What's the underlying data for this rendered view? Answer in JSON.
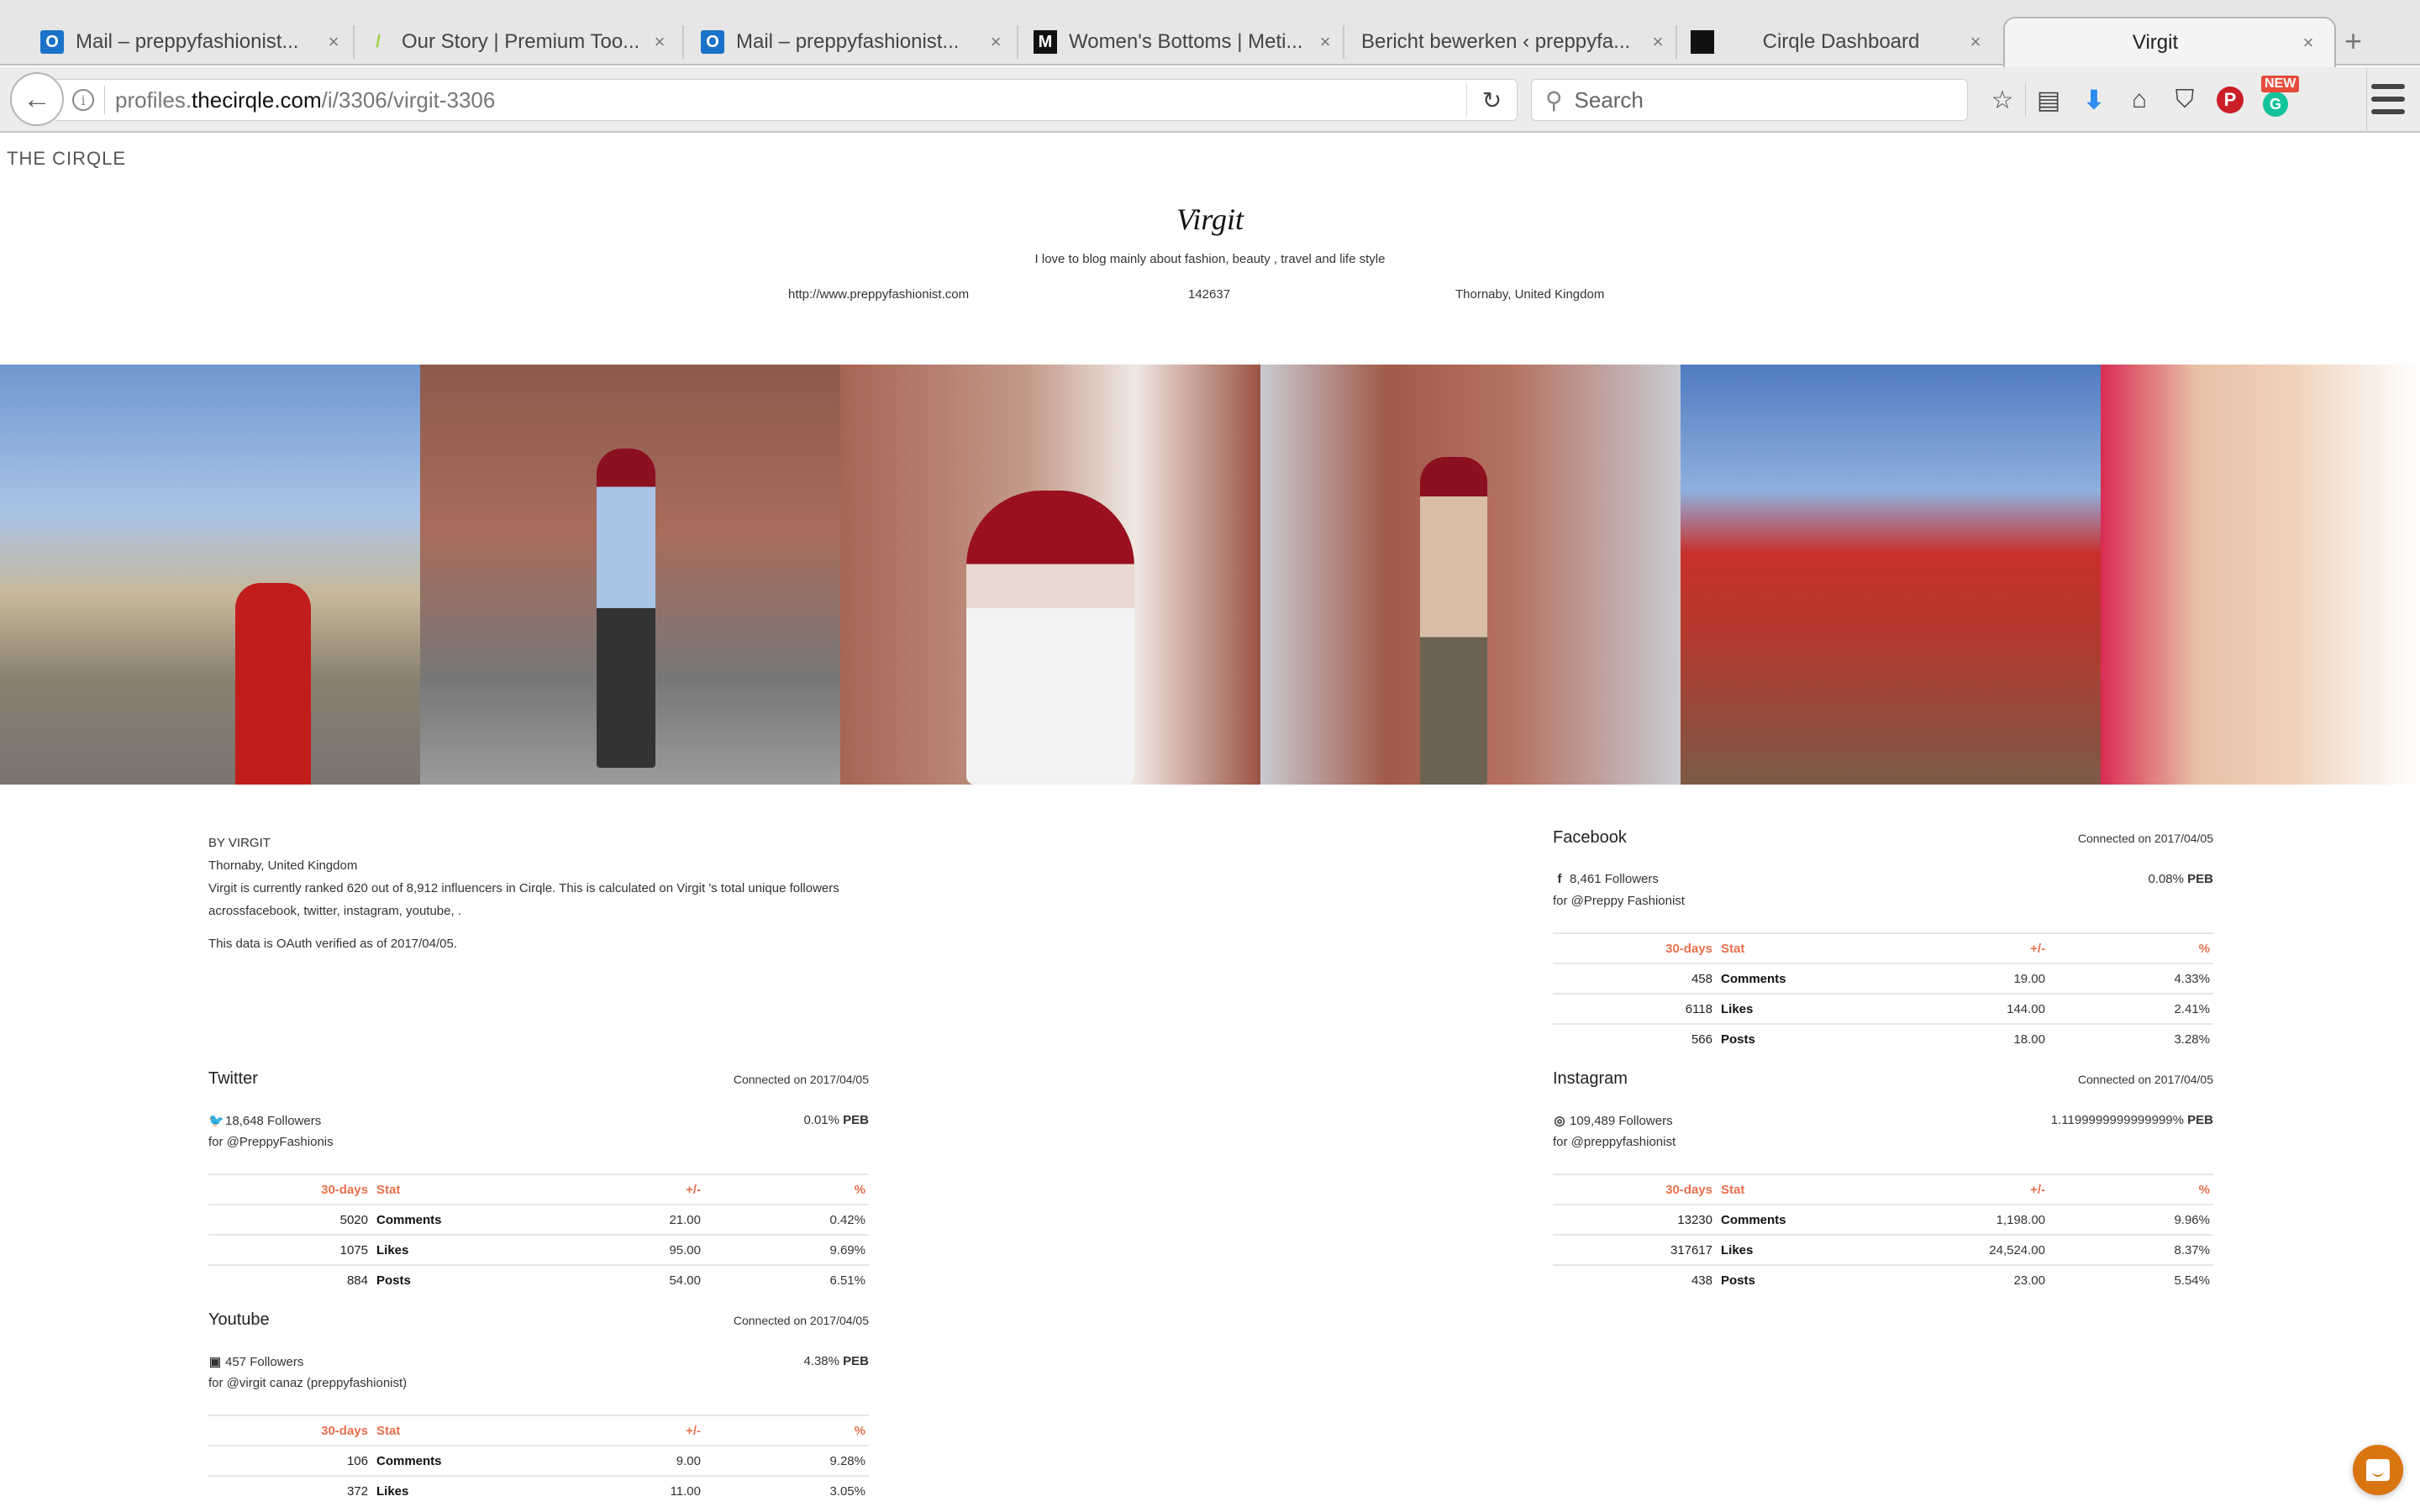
{
  "browser": {
    "tabs": [
      {
        "title": "Mail – preppyfashionist...",
        "favicon": "outlook-icon",
        "active": false
      },
      {
        "title": "Our Story | Premium Too...",
        "favicon": "leaf-icon",
        "active": false
      },
      {
        "title": "Mail – preppyfashionist...",
        "favicon": "outlook-icon",
        "active": false
      },
      {
        "title": "Women's Bottoms | Meti...",
        "favicon": "m-logo-icon",
        "active": false
      },
      {
        "title": "Bericht bewerken ‹ preppyfa...",
        "favicon": "none",
        "active": false
      },
      {
        "title": "Cirqle Dashboard",
        "favicon": "cirqle-icon",
        "active": false
      },
      {
        "title": "Virgit",
        "favicon": "none",
        "active": true
      }
    ],
    "close_glyph": "×",
    "new_tab_glyph": "+",
    "url": {
      "prefix": "profiles.",
      "host": "thecirqle.com",
      "path": "/i/3306/virgit-3306"
    },
    "search_placeholder": "Search",
    "new_badge": "NEW"
  },
  "page": {
    "brand": "THE CIRQLE",
    "profile": {
      "name": "Virgit",
      "bio": "I love to blog mainly about fashion, beauty , travel and life style",
      "website": "http://www.preppyfashionist.com",
      "reach": "142637",
      "location": "Thornaby, United Kingdom"
    },
    "gallery_alts": [
      "London street with red telephone box",
      "Woman in blue blouse under brick archway",
      "Portrait in white lace blouse by brick wall",
      "Woman in camel coat by brick building",
      "Chinatown street with red lanterns",
      "Close-up portrait with turquoise earring"
    ],
    "about": {
      "by": "BY VIRGIT",
      "location": "Thornaby, United Kingdom",
      "rank_text": "Virgit is currently ranked 620 out of 8,912 influencers in Cirqle. This is calculated on Virgit 's total unique followers",
      "networks_text": "acrossfacebook, twitter, instagram, youtube, .",
      "verified_text": "This data is OAuth verified as of 2017/04/05."
    },
    "stats_headers": {
      "period": "30-days",
      "stat": "Stat",
      "delta": "+/-",
      "pct": "%"
    },
    "peb_label": "PEB",
    "networks": {
      "facebook": {
        "name": "Facebook",
        "icon": "f",
        "connected": "Connected on 2017/04/05",
        "followers": "8,461 Followers",
        "peb": "0.08%",
        "handle": "for @Preppy Fashionist",
        "rows": [
          {
            "value": "458",
            "label": "Comments",
            "delta": "19.00",
            "pct": "4.33%"
          },
          {
            "value": "6118",
            "label": "Likes",
            "delta": "144.00",
            "pct": "2.41%"
          },
          {
            "value": "566",
            "label": "Posts",
            "delta": "18.00",
            "pct": "3.28%"
          }
        ]
      },
      "twitter": {
        "name": "Twitter",
        "icon": "🐦",
        "connected": "Connected on 2017/04/05",
        "followers": "18,648 Followers",
        "peb": "0.01%",
        "handle": "for @PreppyFashionis",
        "rows": [
          {
            "value": "5020",
            "label": "Comments",
            "delta": "21.00",
            "pct": "0.42%"
          },
          {
            "value": "1075",
            "label": "Likes",
            "delta": "95.00",
            "pct": "9.69%"
          },
          {
            "value": "884",
            "label": "Posts",
            "delta": "54.00",
            "pct": "6.51%"
          }
        ]
      },
      "instagram": {
        "name": "Instagram",
        "icon": "◎",
        "connected": "Connected on 2017/04/05",
        "followers": "109,489 Followers",
        "peb": "1.1199999999999999%",
        "handle": "for @preppyfashionist",
        "rows": [
          {
            "value": "13230",
            "label": "Comments",
            "delta": "1,198.00",
            "pct": "9.96%"
          },
          {
            "value": "317617",
            "label": "Likes",
            "delta": "24,524.00",
            "pct": "8.37%"
          },
          {
            "value": "438",
            "label": "Posts",
            "delta": "23.00",
            "pct": "5.54%"
          }
        ]
      },
      "youtube": {
        "name": "Youtube",
        "icon": "▣",
        "connected": "Connected on 2017/04/05",
        "followers": "457 Followers",
        "peb": "4.38%",
        "handle": "for @virgit canaz (preppyfashionist)",
        "rows": [
          {
            "value": "106",
            "label": "Comments",
            "delta": "9.00",
            "pct": "9.28%"
          },
          {
            "value": "372",
            "label": "Likes",
            "delta": "11.00",
            "pct": "3.05%"
          }
        ]
      }
    }
  },
  "colors": {
    "accent_orange": "#e8704e",
    "chat_button": "#d8750f",
    "divider": "#e3e6ea"
  }
}
